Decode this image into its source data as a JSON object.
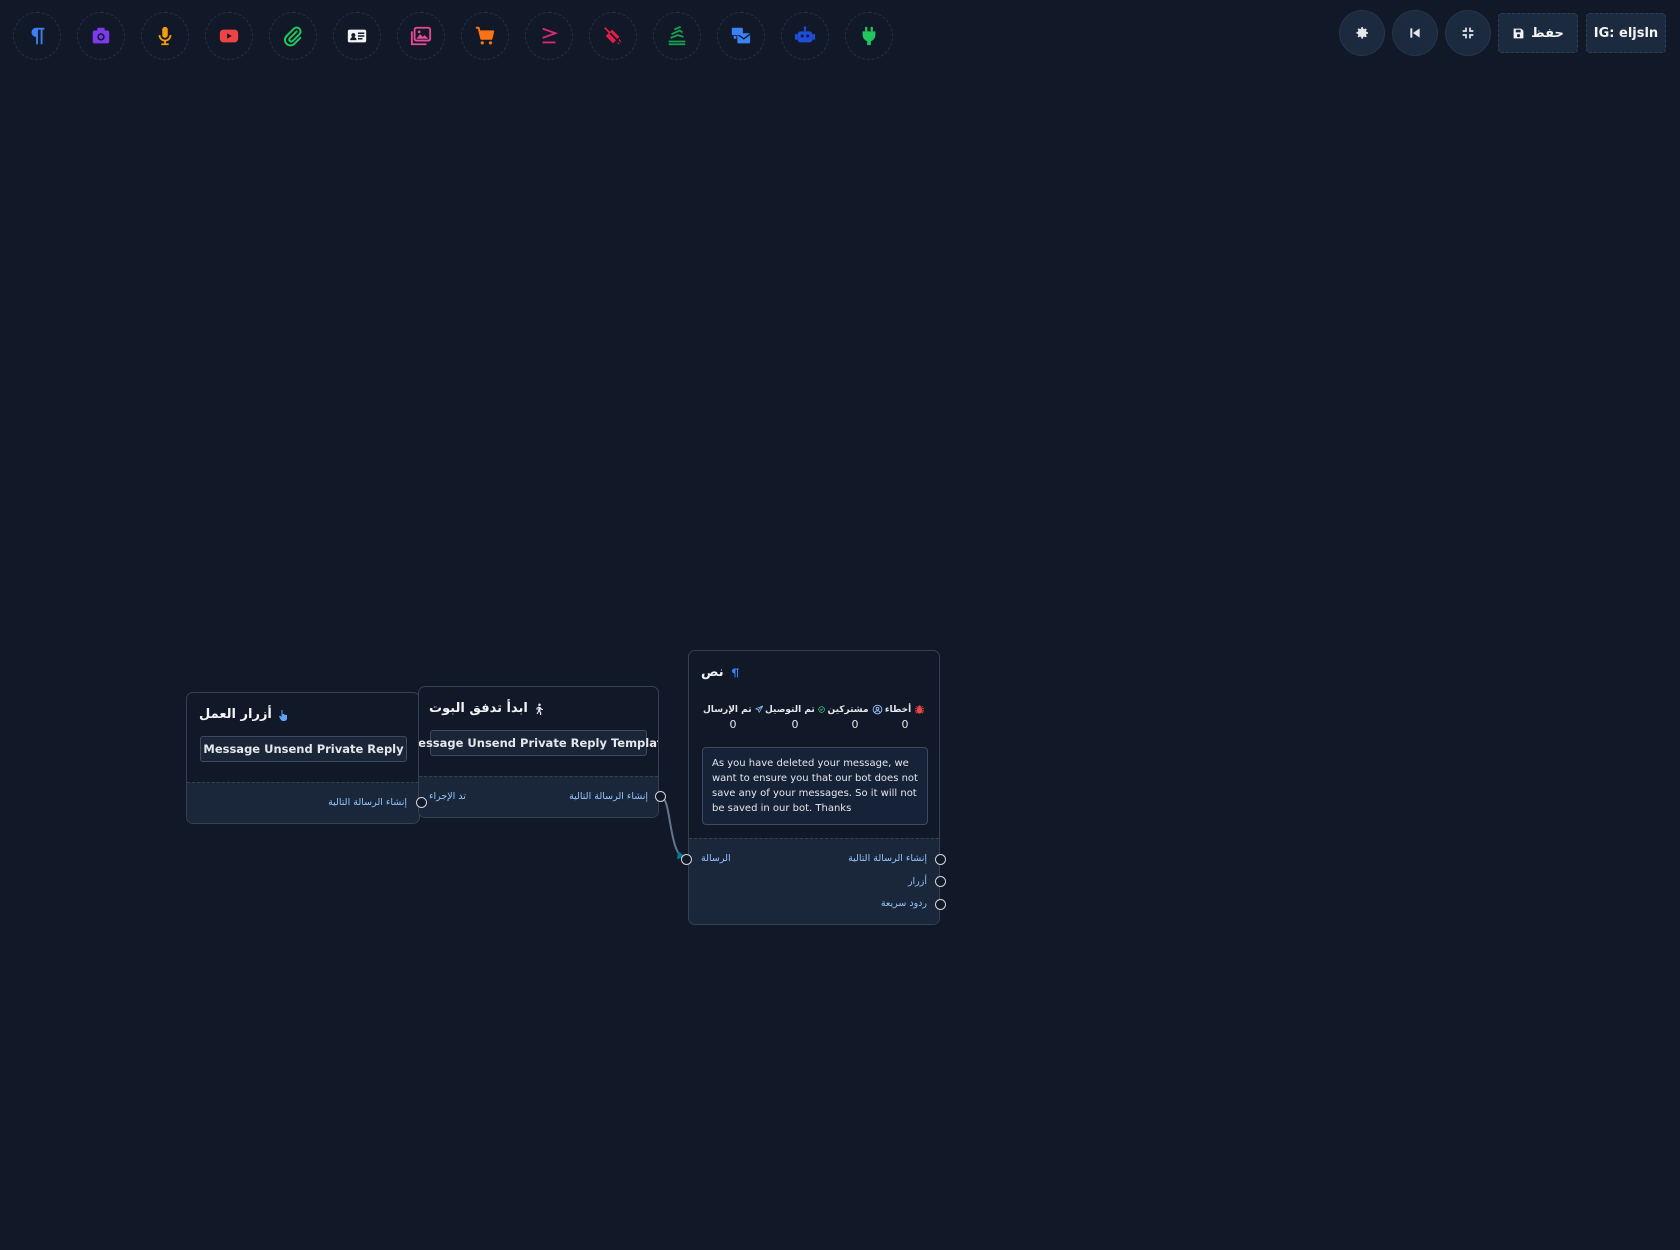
{
  "toolbar": {
    "tools": [
      {
        "name": "text-tool-button",
        "icon": "paragraph-icon",
        "color": "#3b82f6"
      },
      {
        "name": "image-tool-button",
        "icon": "camera-icon",
        "color": "#7c3aed"
      },
      {
        "name": "audio-tool-button",
        "icon": "microphone-icon",
        "color": "#f59e0b"
      },
      {
        "name": "video-tool-button",
        "icon": "youtube-icon",
        "color": "#ef4444"
      },
      {
        "name": "file-tool-button",
        "icon": "paperclip-icon",
        "color": "#22c55e"
      },
      {
        "name": "card-tool-button",
        "icon": "id-card-icon",
        "color": "#f3f4f6"
      },
      {
        "name": "gallery-tool-button",
        "icon": "images-icon",
        "color": "#ec4899"
      },
      {
        "name": "ecommerce-tool-button",
        "icon": "cart-icon",
        "color": "#f97316"
      },
      {
        "name": "condition-tool-button",
        "icon": "greater-equal-icon",
        "color": "#db2777"
      },
      {
        "name": "fill-tool-button",
        "icon": "paint-bucket-icon",
        "color": "#e11d48"
      },
      {
        "name": "stack-tool-button",
        "icon": "stack-icon",
        "color": "#16a34a"
      },
      {
        "name": "email-tool-button",
        "icon": "mail-bulk-icon",
        "color": "#3b82f6"
      },
      {
        "name": "robot-tool-button",
        "icon": "robot-icon",
        "color": "#1d4ed8"
      },
      {
        "name": "plugin-tool-button",
        "icon": "plug-icon",
        "color": "#22c55e"
      }
    ],
    "save_label": "حفظ",
    "account_label": "IG: eljsln"
  },
  "nodes": {
    "action_buttons": {
      "title": "أزرار العمل",
      "chip": "Message Unsend Private Reply",
      "port_next": "إنشاء الرسالة التالية"
    },
    "start_flow": {
      "title": "ابدأ تدفق البوت",
      "chip": "Message Unsend Private Reply Template",
      "port_action": "تد الإجراء",
      "port_next": "إنشاء الرسالة التالية"
    },
    "text": {
      "title": "نص",
      "stats": [
        {
          "label": "تم الإرسال",
          "value": "0",
          "icon": "paper-plane-icon",
          "color": "#93c5fd"
        },
        {
          "label": "تم التوصيل",
          "value": "0",
          "icon": "check-circle-icon",
          "color": "#4ade80"
        },
        {
          "label": "مشتركين",
          "value": "0",
          "icon": "user-circle-icon",
          "color": "#93c5fd"
        },
        {
          "label": "أخطاء",
          "value": "0",
          "icon": "bug-icon",
          "color": "#ef4444"
        }
      ],
      "message": " As you have deleted your message, we want to ensure you that our bot does not save any of your messages. So it will not be saved in our bot. Thanks",
      "port_in": "الرسالة",
      "port_next": "إنشاء الرسالة التالية",
      "port_buttons": "أزرار",
      "port_quick": "ردود سريعة"
    }
  }
}
